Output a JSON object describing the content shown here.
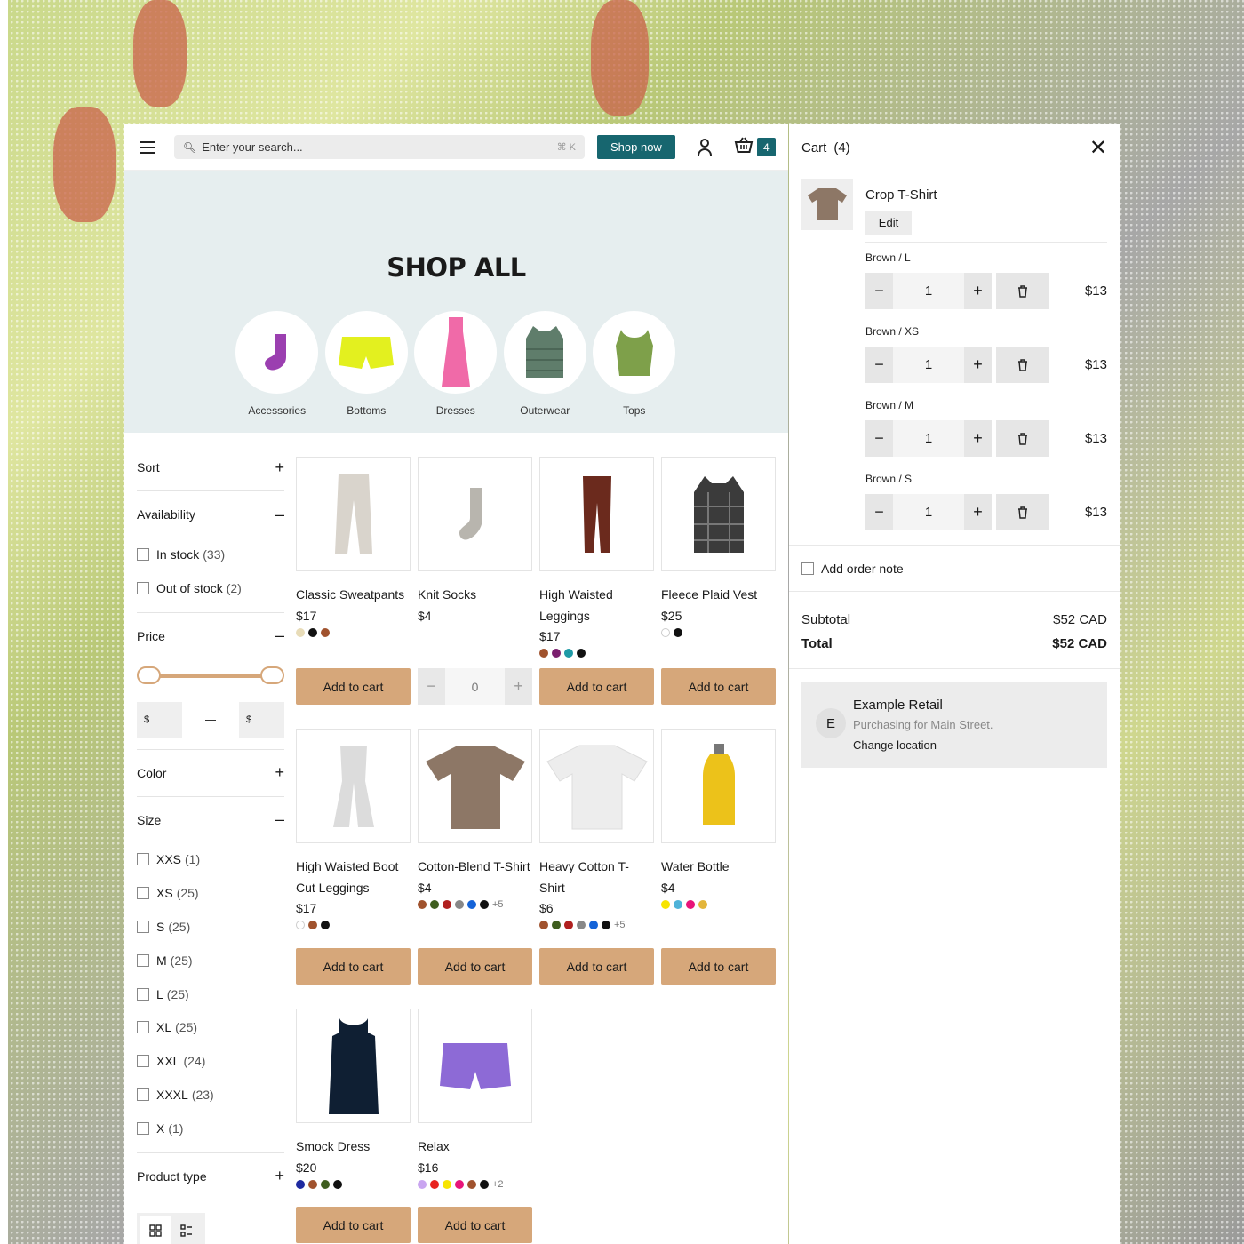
{
  "header": {
    "search_placeholder": "Enter your search...",
    "search_shortcut": "⌘ K",
    "shop_now_label": "Shop now",
    "cart_count": "4"
  },
  "hero": {
    "title": "SHOP ALL",
    "categories": [
      {
        "label": "Accessories"
      },
      {
        "label": "Bottoms"
      },
      {
        "label": "Dresses"
      },
      {
        "label": "Outerwear"
      },
      {
        "label": "Tops"
      }
    ]
  },
  "filters": {
    "sort_label": "Sort",
    "availability_label": "Availability",
    "availability_options": [
      {
        "label": "In stock",
        "count": "(33)"
      },
      {
        "label": "Out of stock",
        "count": "(2)"
      }
    ],
    "price_label": "Price",
    "price_min_currency": "$",
    "price_max_currency": "$",
    "color_label": "Color",
    "size_label": "Size",
    "size_options": [
      {
        "label": "XXS",
        "count": "(1)"
      },
      {
        "label": "XS",
        "count": "(25)"
      },
      {
        "label": "S",
        "count": "(25)"
      },
      {
        "label": "M",
        "count": "(25)"
      },
      {
        "label": "L",
        "count": "(25)"
      },
      {
        "label": "XL",
        "count": "(25)"
      },
      {
        "label": "XXL",
        "count": "(24)"
      },
      {
        "label": "XXXL",
        "count": "(23)"
      },
      {
        "label": "X",
        "count": "(1)"
      }
    ],
    "product_type_label": "Product type"
  },
  "products": [
    {
      "name": "Classic Sweatpants",
      "price": "$17",
      "swatches": [
        "#e8dcb8",
        "#111111",
        "#a0522d"
      ],
      "action": "Add to cart"
    },
    {
      "name": "Knit Socks",
      "price": "$4",
      "swatches": [],
      "stepper_value": "0"
    },
    {
      "name": "High Waisted Leggings",
      "price": "$17",
      "swatches": [
        "#a0522d",
        "#7b1f6e",
        "#1f9aa6",
        "#111111"
      ],
      "action": "Add to cart"
    },
    {
      "name": "Fleece Plaid Vest",
      "price": "$25",
      "swatches": [
        "#ffffff",
        "#111111"
      ],
      "action": "Add to cart"
    },
    {
      "name": "High Waisted Boot Cut Leggings",
      "price": "$17",
      "swatches": [
        "#ffffff",
        "#a0522d",
        "#111111"
      ],
      "action": "Add to cart"
    },
    {
      "name": "Cotton-Blend T-Shirt",
      "price": "$4",
      "swatches": [
        "#a0522d",
        "#3f5e1f",
        "#b0201f",
        "#888888",
        "#1463d8",
        "#111111"
      ],
      "more": "+5",
      "action": "Add to cart"
    },
    {
      "name": "Heavy Cotton T-Shirt",
      "price": "$6",
      "swatches": [
        "#a0522d",
        "#3f5e1f",
        "#b0201f",
        "#888888",
        "#1463d8",
        "#111111"
      ],
      "more": "+5",
      "action": "Add to cart"
    },
    {
      "name": "Water Bottle",
      "price": "$4",
      "swatches": [
        "#f7e400",
        "#4fb3d9",
        "#e8147a",
        "#e3b53a"
      ],
      "action": "Add to cart"
    },
    {
      "name": "Smock Dress",
      "price": "$20",
      "swatches": [
        "#1f2aa0",
        "#a0522d",
        "#3f5e1f",
        "#111111"
      ],
      "action": "Add to cart"
    },
    {
      "name": "Relax",
      "price": "$16",
      "swatches": [
        "#c9a5f0",
        "#e8231f",
        "#f7e400",
        "#e8147a",
        "#a0522d",
        "#111111"
      ],
      "more": "+2",
      "action": "Add to cart"
    }
  ],
  "cart": {
    "title": "Cart",
    "count": "(4)",
    "item_name": "Crop T-Shirt",
    "edit_label": "Edit",
    "variants": [
      {
        "label": "Brown / L",
        "qty": "1",
        "price": "$13"
      },
      {
        "label": "Brown / XS",
        "qty": "1",
        "price": "$13"
      },
      {
        "label": "Brown / M",
        "qty": "1",
        "price": "$13"
      },
      {
        "label": "Brown / S",
        "qty": "1",
        "price": "$13"
      }
    ],
    "order_note_label": "Add order note",
    "subtotal_label": "Subtotal",
    "subtotal_value": "$52 CAD",
    "total_label": "Total",
    "total_value": "$52 CAD",
    "location": {
      "avatar_letter": "E",
      "company": "Example Retail",
      "purchasing_for": "Purchasing for Main Street.",
      "change_label": "Change location"
    }
  },
  "colors": {
    "accent": "#17666f",
    "button": "#d6a77a",
    "hero_bg": "#e6eeef"
  }
}
